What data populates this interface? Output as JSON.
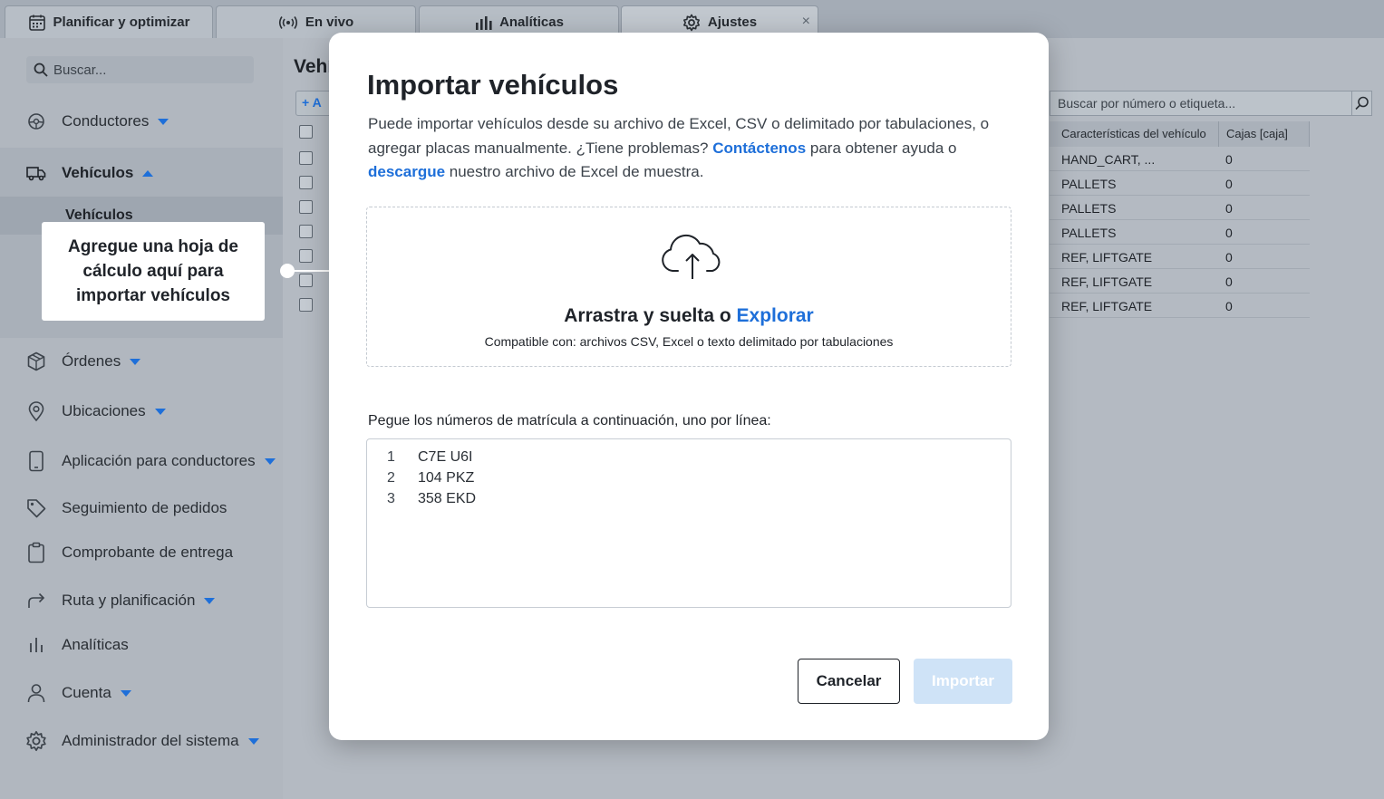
{
  "tabs": [
    {
      "label": "Planificar y optimizar",
      "icon": "calendar-icon"
    },
    {
      "label": "En vivo",
      "icon": "broadcast-icon"
    },
    {
      "label": "Analíticas",
      "icon": "bar-chart-icon"
    },
    {
      "label": "Ajustes",
      "icon": "gear-icon",
      "close": "×"
    }
  ],
  "sidebar": {
    "search_placeholder": "Buscar...",
    "items": [
      {
        "label": "Conductores",
        "icon": "driver-icon"
      },
      {
        "label": "Vehículos",
        "icon": "truck-icon"
      },
      {
        "label": "Órdenes",
        "icon": "box-icon"
      },
      {
        "label": "Ubicaciones",
        "icon": "location-pin-icon"
      },
      {
        "label": "Aplicación para conductores",
        "icon": "phone-icon"
      },
      {
        "label": "Seguimiento de pedidos",
        "icon": "tag-icon"
      },
      {
        "label": "Comprobante de entrega",
        "icon": "clipboard-icon"
      },
      {
        "label": "Ruta y planificación",
        "icon": "route-arrow-icon"
      },
      {
        "label": "Analíticas",
        "icon": "bar-chart-icon"
      },
      {
        "label": "Cuenta",
        "icon": "user-icon"
      },
      {
        "label": "Administrador del sistema",
        "icon": "gear-icon"
      }
    ],
    "subitem": "Vehículos"
  },
  "tooltip": {
    "text": "Agregue una hoja de cálculo aquí para importar vehículos"
  },
  "main": {
    "title": "Vehí",
    "add_label": "A",
    "table_search_placeholder": "Buscar por número o etiqueta...",
    "columns": [
      "Características del vehículo",
      "Cajas [caja]"
    ],
    "rows": [
      [
        "HAND_CART, ...",
        "0"
      ],
      [
        "PALLETS",
        "0"
      ],
      [
        "PALLETS",
        "0"
      ],
      [
        "PALLETS",
        "0"
      ],
      [
        "REF, LIFTGATE",
        "0"
      ],
      [
        "REF, LIFTGATE",
        "0"
      ],
      [
        "REF, LIFTGATE",
        "0"
      ]
    ]
  },
  "modal": {
    "title": "Importar vehículos",
    "desc_1": "Puede importar vehículos desde su archivo de Excel, CSV o delimitado por tabulaciones, o agregar placas manualmente. ¿Tiene problemas? ",
    "desc_link_contact": "Contáctenos",
    "desc_2": " para obtener ayuda o ",
    "desc_link_download": "descargue",
    "desc_3": " nuestro archivo de Excel de muestra.",
    "drop_title": "Arrastra y suelta o ",
    "drop_link": "Explorar",
    "drop_sub": "Compatible con: archivos CSV, Excel o texto delimitado por tabulaciones",
    "paste_label": "Pegue los números de matrícula a continuación, uno por línea:",
    "plates": [
      {
        "n": "1",
        "v": "C7E U6I"
      },
      {
        "n": "2",
        "v": "104 PKZ"
      },
      {
        "n": "3",
        "v": "358 EKD"
      }
    ],
    "cancel": "Cancelar",
    "import": "Importar"
  },
  "colors": {
    "accent": "#1e6fd9",
    "import_disabled": "#cfe3f7"
  }
}
